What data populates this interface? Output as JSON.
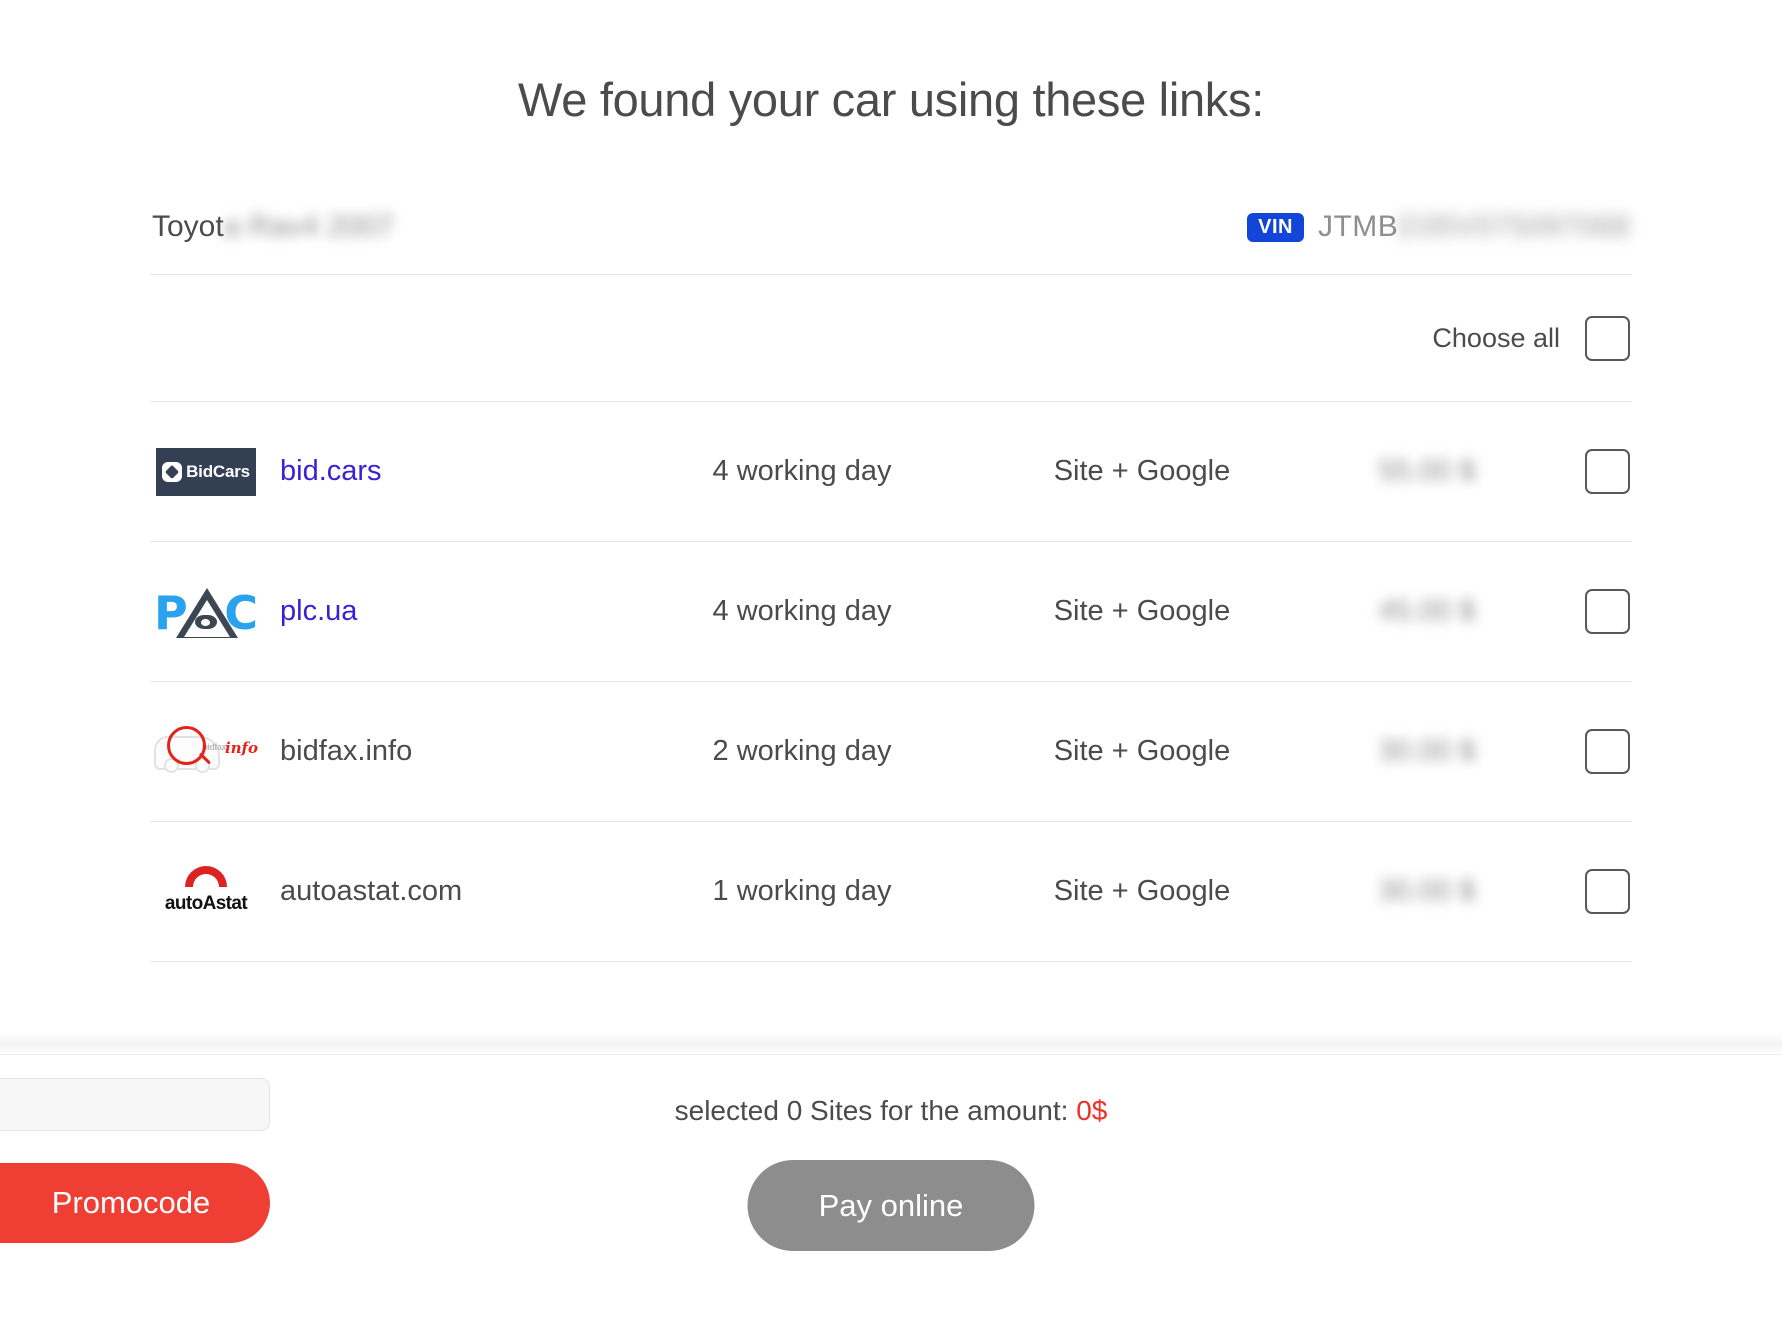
{
  "header": {
    "title": "We found your car using these links:"
  },
  "car": {
    "name_visible": "Toyot",
    "name_blurred": "a Rav4 2007",
    "vin_badge": "VIN",
    "vin_visible": "JTMB",
    "vin_blurred": "D35V075097068"
  },
  "table": {
    "choose_all_label": "Choose all",
    "rows": [
      {
        "logo": "bidcars-logo",
        "site": "bid.cars",
        "is_link": true,
        "days": "4 working day",
        "type": "Site + Google",
        "price": "55.00 $"
      },
      {
        "logo": "plc-logo",
        "site": "plc.ua",
        "is_link": true,
        "days": "4 working day",
        "type": "Site + Google",
        "price": "45.00 $"
      },
      {
        "logo": "bidfax-logo",
        "site": "bidfax.info",
        "is_link": false,
        "days": "2 working day",
        "type": "Site + Google",
        "price": "30.00 $"
      },
      {
        "logo": "autoastat-logo",
        "site": "autoastat.com",
        "is_link": false,
        "days": "1 working day",
        "type": "Site + Google",
        "price": "30.00 $"
      }
    ]
  },
  "logos": {
    "bidcars_text": "BidCars",
    "bidfax_word": "bidfax",
    "bidfax_info": "info",
    "autoastat_lower": "auto",
    "autoastat_upper": "Astat",
    "plc_p": "P",
    "plc_c": "C"
  },
  "footer": {
    "promocode_placeholder": "",
    "promocode_value": "",
    "promocode_button": "Promocode",
    "summary_prefix": "selected 0 Sites for the amount:",
    "summary_amount": "0$",
    "pay_button": "Pay online"
  },
  "colors": {
    "accent_red": "#ef3e33",
    "vin_blue": "#1346d8",
    "link_blue": "#3a21d6",
    "disabled_gray": "#8d8d8d"
  }
}
